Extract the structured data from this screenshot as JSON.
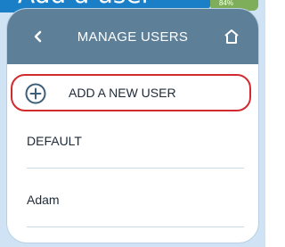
{
  "caption": {
    "text": "Add a user",
    "battery_text": "84%"
  },
  "header": {
    "back_icon": "chevron-left-icon",
    "title": "MANAGE USERS",
    "home_icon": "home-icon"
  },
  "add_user": {
    "icon": "plus-circle-icon",
    "label": "ADD A NEW USER",
    "highlight_color": "#d12a2f"
  },
  "users": [
    {
      "name": "DEFAULT"
    },
    {
      "name": "Adam"
    }
  ],
  "colors": {
    "header": "#5d7f98",
    "caption_bg": "#1b7fc8",
    "frame": "#cfe3f4"
  }
}
